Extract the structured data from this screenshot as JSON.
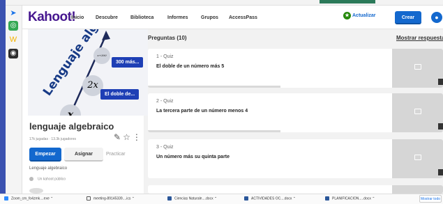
{
  "brand": {
    "logo": "Kahoot!",
    "color": "#46178f"
  },
  "nav": {
    "items": [
      "Inicio",
      "Descubre",
      "Biblioteca",
      "Informes",
      "Grupos",
      "AccessPass"
    ]
  },
  "header_actions": {
    "update_label": "Actualizar",
    "create_label": "Crear"
  },
  "kahoot": {
    "cover": {
      "title": "Lenguaje algebraico",
      "pill_1": "300 más...",
      "pill_2": "El doble de...",
      "node_1": "2x",
      "node_2": "x"
    },
    "title": "lenguaje algebraico",
    "stats": "17k jugadas · 13.3k jugadores",
    "play_label": "Empezar",
    "assign_label": "Asignar",
    "practice_label": "Practicar",
    "description": "Lenguaje algebraico",
    "visibility": "Un kahoot público"
  },
  "questions": {
    "header": "Preguntas (10)",
    "show_answers": "Mostrar respuestas",
    "items": [
      {
        "num": "1 - Quiz",
        "text": "El doble de un número más 5"
      },
      {
        "num": "2 - Quiz",
        "text": "La tercera parte de un número menos 4"
      },
      {
        "num": "3 - Quiz",
        "text": "Un número más su quinta parte"
      }
    ]
  },
  "taskbar": {
    "items": [
      "Zoom_cm_fo4zmk....exe",
      "meeting-89145339....ics",
      "Ciencias Naturale....docx",
      "ACTIVIDADES OC....docx",
      "PLANIFICACION.....docx"
    ],
    "show_all": "Mostrar todo"
  },
  "colors": {
    "accent": "#1368ce",
    "cover_pill": "#1e3fb5",
    "cover_title": "#173a86",
    "update_icon": "#26890c"
  }
}
